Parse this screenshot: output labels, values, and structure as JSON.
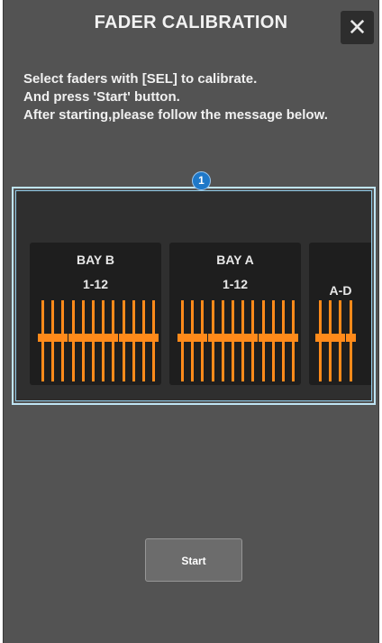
{
  "dialog": {
    "title": "FADER CALIBRATION",
    "close_icon": "close-icon",
    "close_glyph": "✕"
  },
  "instructions": [
    "Select faders with [SEL] to calibrate.",
    "And press 'Start' button.",
    "After starting,please follow the message below."
  ],
  "callout": {
    "number": "1",
    "accent_color": "#1f78c8"
  },
  "bays": [
    {
      "name": "BAY B",
      "range": "1-12",
      "fader_count": 12
    },
    {
      "name": "BAY A",
      "range": "1-12",
      "fader_count": 12
    },
    {
      "name": "",
      "range": "A-D",
      "fader_count": 4
    }
  ],
  "colors": {
    "fader_accent": "#ff8a1a",
    "selection_border": "#bfe4f4"
  },
  "start_button": {
    "label": "Start"
  }
}
